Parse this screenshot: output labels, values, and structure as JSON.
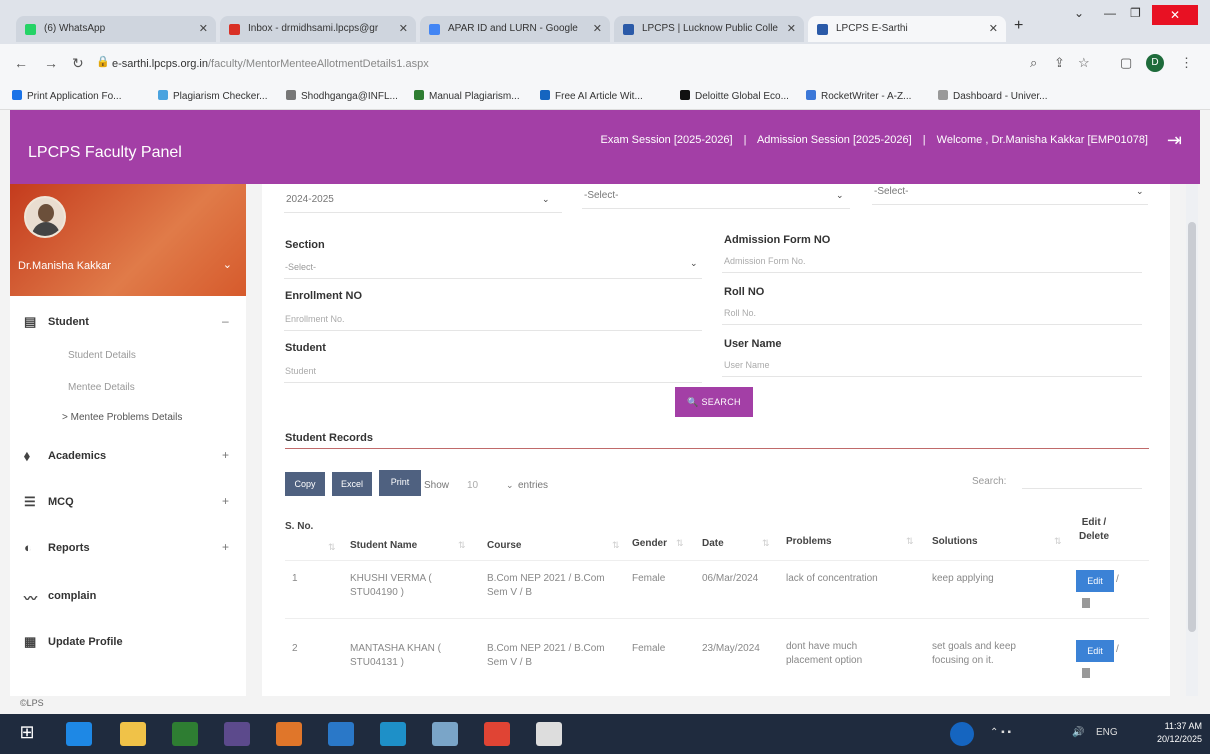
{
  "browser": {
    "tabs": [
      {
        "label": "(6) WhatsApp",
        "color": "#25d366"
      },
      {
        "label": "Inbox - drmidhsami.lpcps@gr",
        "color": "#d93025"
      },
      {
        "label": "APAR ID and LURN - Google",
        "color": "#4285f4"
      },
      {
        "label": "LPCPS | Lucknow Public Colle",
        "color": "#2b5aa8"
      },
      {
        "label": "LPCPS E-Sarthi",
        "color": "#2b5aa8"
      }
    ],
    "url_domain": "e-sarthi.lpcps.org.in",
    "url_path": "/faculty/MentorMenteeAllotmentDetails1.aspx",
    "profile_initial": "D",
    "bookmarks": [
      "Print Application Fo...",
      "Plagiarism Checker...",
      "Shodhganga@INFL...",
      "Manual Plagiarism...",
      "Free AI Article Wit...",
      "Deloitte Global Eco...",
      "RocketWriter - A-Z...",
      "Dashboard - Univer..."
    ]
  },
  "header": {
    "title": "LPCPS Faculty Panel",
    "exam_session": "Exam Session [2025-2026]",
    "admission_session": "Admission Session [2025-2026]",
    "welcome": "Welcome , Dr.Manisha Kakkar [EMP01078]",
    "accent_color": "#a33fa6"
  },
  "sidebar": {
    "profile_name": "Dr.Manisha Kakkar",
    "items": [
      {
        "label": "Student",
        "expander": "–"
      },
      {
        "label": "Academics",
        "expander": "+"
      },
      {
        "label": "MCQ",
        "expander": "+"
      },
      {
        "label": "Reports",
        "expander": "+"
      },
      {
        "label": "complain",
        "expander": ""
      },
      {
        "label": "Update Profile",
        "expander": ""
      }
    ],
    "sub_items": [
      "Student Details",
      "Mentee Details",
      "> Mentee Problems Details"
    ],
    "footer": "©LPS"
  },
  "filters": {
    "session_value": "2024-2025",
    "select2_value": "-Select-",
    "select3_value": "-Select-",
    "section_label": "Section",
    "section_value": "-Select-",
    "admission_label": "Admission Form NO",
    "admission_placeholder": "Admission Form No.",
    "enrollment_label": "Enrollment NO",
    "enrollment_placeholder": "Enrollment No.",
    "roll_label": "Roll NO",
    "roll_placeholder": "Roll No.",
    "student_label": "Student",
    "student_placeholder": "Student",
    "username_label": "User Name",
    "username_placeholder": "User Name",
    "search_button": "🔍 SEARCH"
  },
  "records": {
    "title": "Student Records",
    "buttons": [
      "Copy",
      "Excel",
      "Print"
    ],
    "show": "Show",
    "entries_value": "10",
    "entries": "entries",
    "search": "Search:",
    "columns": [
      "S. No.",
      "Student Name",
      "Course",
      "Gender",
      "Date",
      "Problems",
      "Solutions",
      "Edit / Delete"
    ],
    "rows": [
      {
        "sno": "1",
        "name": "KHUSHI VERMA ( STU04190 )",
        "course": "B.Com NEP 2021 / B.Com Sem V / B",
        "gender": "Female",
        "date": "06/Mar/2024",
        "problems": "lack of concentration",
        "solutions": "keep applying",
        "edit": "Edit"
      },
      {
        "sno": "2",
        "name": "MANTASHA KHAN ( STU04131 )",
        "course": "B.Com NEP 2021 / B.Com Sem V / B",
        "gender": "Female",
        "date": "23/May/2024",
        "problems": "dont have much placement option",
        "solutions": "set goals and keep focusing on it.",
        "edit": "Edit"
      }
    ]
  },
  "taskbar": {
    "time": "11:37 AM",
    "date": "20/12/2025",
    "lang": "ENG"
  }
}
